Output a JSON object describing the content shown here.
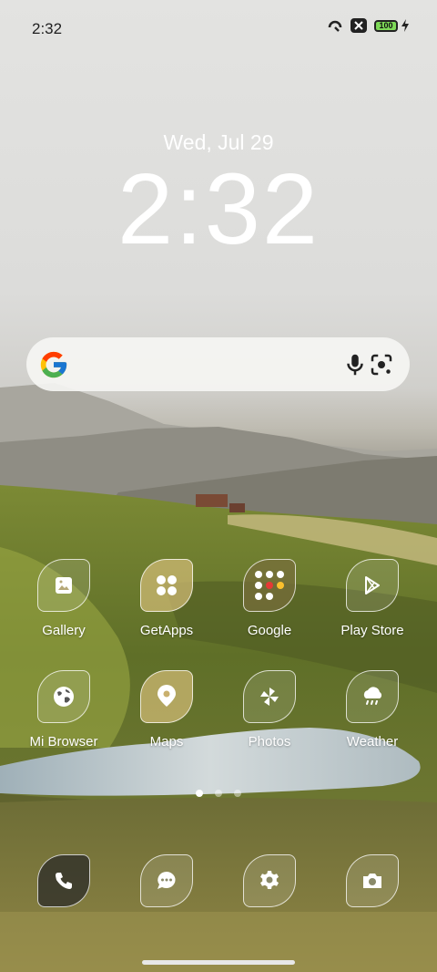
{
  "status_bar": {
    "time": "2:32",
    "battery_level": "100",
    "icons": [
      "data-sync-icon",
      "close-box-icon",
      "battery-icon",
      "charging-bolt-icon"
    ]
  },
  "lock_clock": {
    "date": "Wed, Jul 29",
    "time": "2:32"
  },
  "search_bar": {
    "icons": [
      "google-g-icon",
      "microphone-icon",
      "google-lens-icon"
    ]
  },
  "apps_row1": [
    {
      "label": "Gallery",
      "icon": "gallery-icon"
    },
    {
      "label": "GetApps",
      "icon": "getapps-icon"
    },
    {
      "label": "Google",
      "icon": "google-folder-icon"
    },
    {
      "label": "Play Store",
      "icon": "play-store-icon"
    }
  ],
  "apps_row2": [
    {
      "label": "Mi Browser",
      "icon": "globe-icon"
    },
    {
      "label": "Maps",
      "icon": "maps-pin-icon"
    },
    {
      "label": "Photos",
      "icon": "pinwheel-icon"
    },
    {
      "label": "Weather",
      "icon": "weather-cloud-icon"
    }
  ],
  "page_indicator": {
    "pages": 3,
    "current": 1
  },
  "dock": [
    {
      "icon": "phone-icon"
    },
    {
      "icon": "messages-icon"
    },
    {
      "icon": "settings-gear-icon"
    },
    {
      "icon": "camera-icon"
    }
  ],
  "colors": {
    "sky": "#e0e0de",
    "grass": "#6b7a2a",
    "lake": "#b9c6cc",
    "battery_fill": "#7ed957"
  }
}
